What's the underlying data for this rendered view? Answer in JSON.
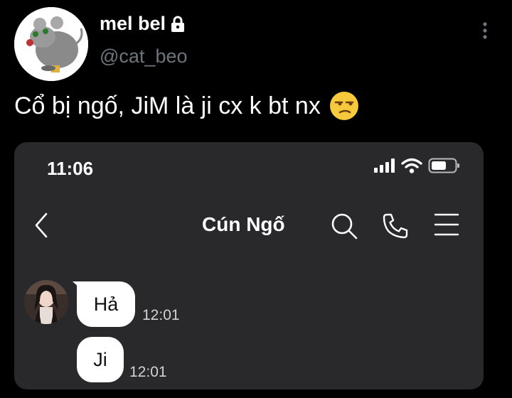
{
  "tweet": {
    "display_name": "mel bel",
    "handle": "@cat_beo",
    "text": "Cổ bị ngố, JiM là ji cx k bt nx",
    "emoji": "unamused-face-icon",
    "icons": {
      "lock": "lock-icon",
      "more": "more-vertical-icon"
    }
  },
  "phone_screenshot": {
    "status_bar": {
      "time": "11:06",
      "icons": [
        "signal-icon",
        "wifi-icon",
        "battery-icon"
      ]
    },
    "chat_header": {
      "contact_name": "Cún Ngố",
      "icons": [
        "back-icon",
        "search-icon",
        "call-icon",
        "menu-icon"
      ]
    },
    "messages": [
      {
        "text": "Hả",
        "time": "12:01"
      },
      {
        "text": "Ji",
        "time": "12:01"
      }
    ]
  },
  "colors": {
    "background": "#000000",
    "text": "#ffffff",
    "secondary_text": "#6e767d",
    "chat_background": "#29292c",
    "bubble": "#ffffff"
  }
}
